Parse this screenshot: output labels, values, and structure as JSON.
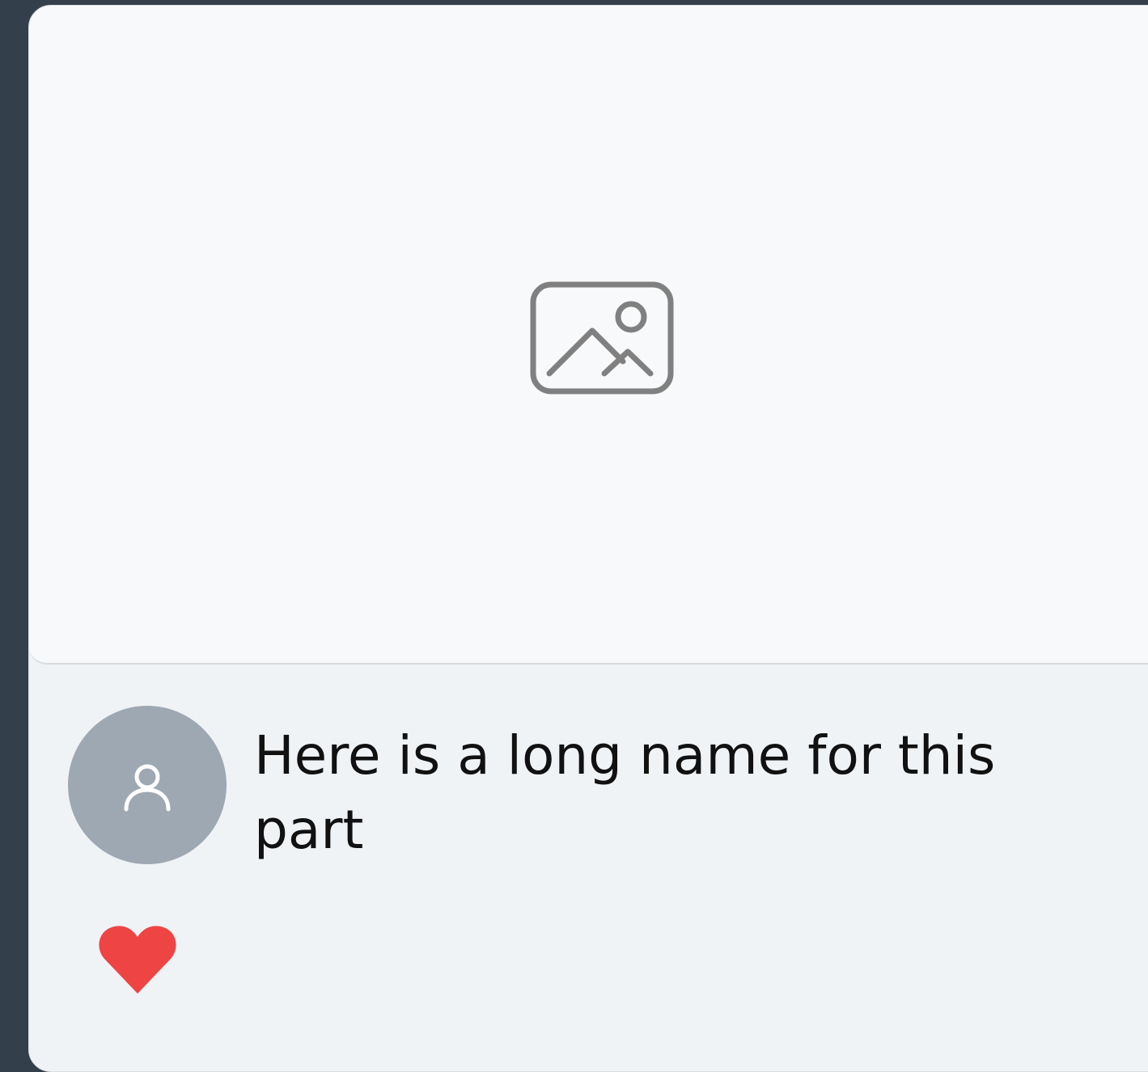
{
  "card": {
    "title": "Here is a long name for this part",
    "media": {
      "icon": "image-placeholder-icon",
      "icon_color": "#808080",
      "background": "#f8f9fa"
    },
    "avatar": {
      "icon": "user-icon",
      "background": "#9ea8b3"
    },
    "like": {
      "icon": "heart-icon",
      "color": "#ef4444",
      "liked": true
    }
  }
}
